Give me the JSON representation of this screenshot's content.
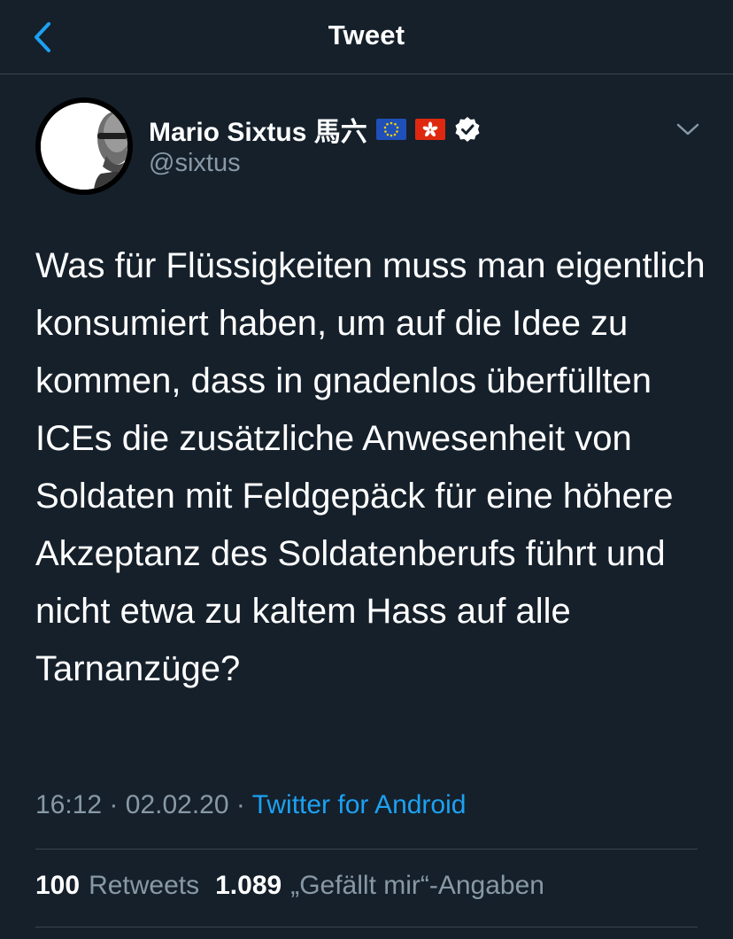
{
  "header": {
    "title": "Tweet"
  },
  "author": {
    "display_name": "Mario Sixtus 馬六",
    "handle": "@sixtus",
    "flags": [
      "eu-flag-icon",
      "hong-kong-flag-icon"
    ],
    "verified": true
  },
  "tweet": {
    "text": "Was für Flüssigkeiten muss man eigentlich konsumiert haben, um auf die Idee zu kommen, dass in gnadenlos überfüllten ICEs die zusätzliche Anwesenheit von Soldaten mit Feldgepäck für eine höhere Akzeptanz des Soldatenberufs führt und nicht etwa zu kaltem Hass auf alle Tarnanzüge?",
    "time": "16:12",
    "date": "02.02.20",
    "separator": "·",
    "source": "Twitter for Android"
  },
  "stats": {
    "retweets_count": "100",
    "retweets_label": "Retweets",
    "likes_count": "1.089",
    "likes_label": "„Gefällt mir“-Angaben"
  },
  "colors": {
    "background": "#15202b",
    "accent": "#1da1f2",
    "secondary_text": "#8899a6",
    "divider": "#38444d"
  }
}
